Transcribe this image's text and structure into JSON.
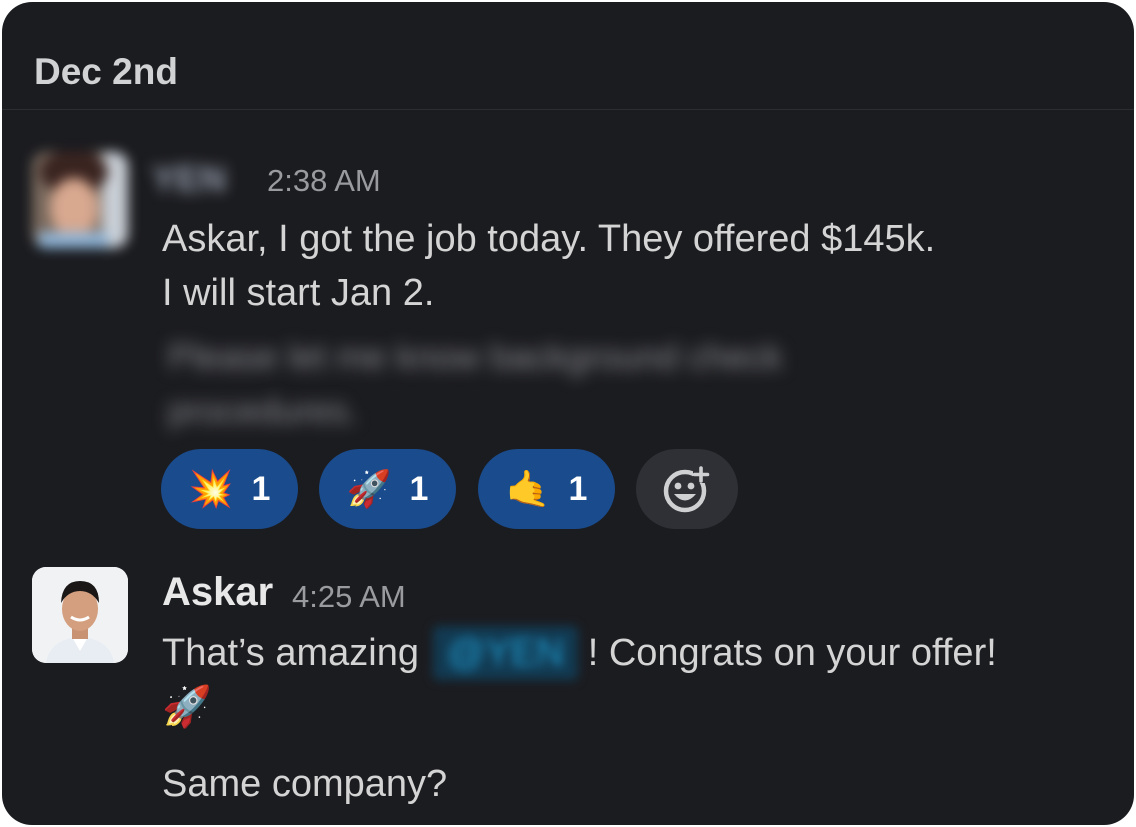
{
  "date_header": "Dec 2nd",
  "messages": [
    {
      "author": "YEN",
      "time": "2:38 AM",
      "lines": [
        "Askar, I got the job today. They offered $145k.",
        "I will start Jan 2."
      ],
      "blurred_lines": [
        "Please let me know background check",
        "procedures."
      ],
      "reactions": [
        {
          "emoji": "💥",
          "count": "1",
          "icon": "collision-icon"
        },
        {
          "emoji": "🚀",
          "count": "1",
          "icon": "rocket-icon"
        },
        {
          "emoji": "🤙",
          "count": "1",
          "icon": "call-me-hand-icon"
        }
      ]
    },
    {
      "author": "Askar",
      "time": "4:25 AM",
      "text_before_mention": "That’s amazing",
      "mention": "@YEN",
      "text_after_mention": "! Congrats on your offer!",
      "emoji_line": "🚀",
      "second_line": "Same company?"
    }
  ],
  "colors": {
    "background": "#1b1c20",
    "reaction_bg": "#1a4b8c",
    "add_reaction_bg": "#2f3035",
    "mention": "#1d9bd1"
  }
}
